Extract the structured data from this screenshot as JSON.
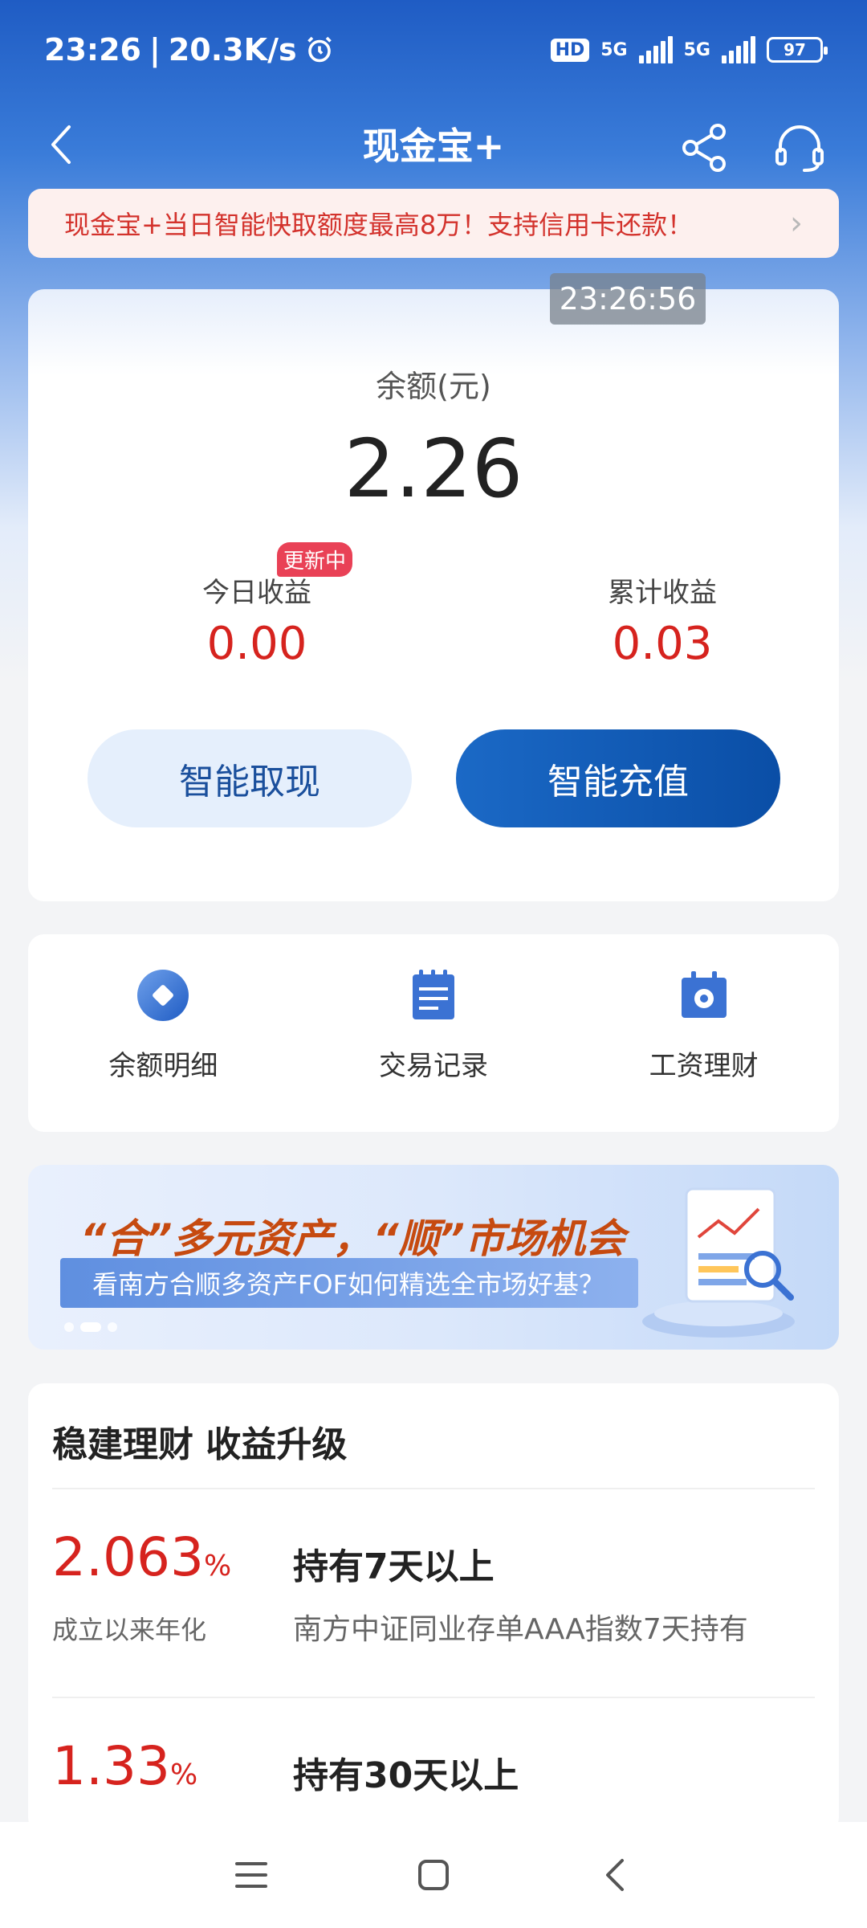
{
  "status_bar": {
    "time": "23:26",
    "speed": "20.3K/s",
    "hd_label": "HD",
    "net1": "5G",
    "net2": "5G",
    "battery": "97"
  },
  "nav": {
    "title": "现金宝+"
  },
  "notice": {
    "text": "现金宝+当日智能快取额度最高8万！支持信用卡还款！"
  },
  "balance": {
    "timestamp": "23:26:56",
    "label": "余额(元)",
    "value": "2.26",
    "today_income_label": "今日收益",
    "today_income_value": "0.00",
    "updating_badge": "更新中",
    "total_income_label": "累计收益",
    "total_income_value": "0.03",
    "withdraw_button": "智能取现",
    "topup_button": "智能充值"
  },
  "shortcuts": [
    {
      "label": "余额明细",
      "icon": "diamond-circle-icon"
    },
    {
      "label": "交易记录",
      "icon": "document-list-icon"
    },
    {
      "label": "工资理财",
      "icon": "wallet-clock-icon"
    }
  ],
  "banner": {
    "title": "“合”多元资产，“顺”市场机会",
    "subtitle": "看南方合顺多资产FOF如何精选全市场好基？",
    "active_slide": 2,
    "slides": 3
  },
  "products": {
    "title": "稳建理财 收益升级",
    "items": [
      {
        "rate": "2.063",
        "rate_unit": "%",
        "rate_label": "成立以来年化",
        "name": "持有7天以上",
        "desc": "南方中证同业存单AAA指数7天持有"
      },
      {
        "rate": "1.33",
        "rate_unit": "%",
        "rate_label": "",
        "name": "持有30天以上",
        "desc": ""
      }
    ]
  },
  "colors": {
    "brand_blue": "#1f5cc4",
    "accent_red": "#d6231e",
    "notice_bg": "#fdf0ee"
  }
}
